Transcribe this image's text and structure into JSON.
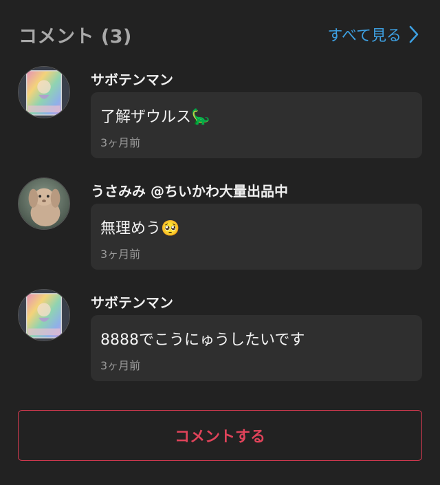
{
  "header": {
    "title": "コメント (3)",
    "see_all_label": "すべて見る",
    "see_all_icon": "chevron-right-icon",
    "accent_color": "#3d9fe0"
  },
  "comments": [
    {
      "username": "サボテンマン",
      "text": "了解ザウルス🦕",
      "time": "3ヶ月前",
      "avatar": "card-avatar"
    },
    {
      "username": "うさみみ @ちいかわ大量出品中",
      "text": "無理めう🥺",
      "time": "3ヶ月前",
      "avatar": "rabbit-avatar"
    },
    {
      "username": "サボテンマン",
      "text": "8888でこうにゅうしたいです",
      "time": "3ヶ月前",
      "avatar": "card-avatar"
    }
  ],
  "footer": {
    "comment_button_label": "コメントする",
    "button_color": "#d2394f"
  }
}
